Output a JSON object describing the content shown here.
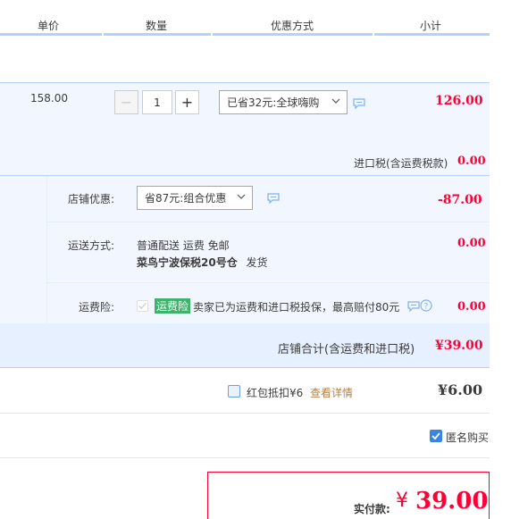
{
  "header": {
    "col_unit_price": "单价",
    "col_quantity": "数量",
    "col_discount": "优惠方式",
    "col_subtotal": "小计"
  },
  "item": {
    "unit_price": "158.00",
    "quantity": "1",
    "minus": "−",
    "plus": "+",
    "discount_select": "已省32元:全球嗨购",
    "subtotal": "126.00",
    "tax_label": "进口税(含运费税款)",
    "tax_value": "0.00"
  },
  "shop": {
    "promo_label": "店铺优惠:",
    "promo_select": "省87元:组合优惠",
    "promo_value": "-87.00",
    "shipping_label": "运送方式:",
    "shipping_line1": "普通配送 运费 免邮",
    "shipping_line2_bold": "菜鸟宁波保税20号仓",
    "shipping_line2_suffix": "发货",
    "shipping_value": "0.00",
    "insurance_label": "运费险:",
    "insurance_tag": "运费险",
    "insurance_text": "卖家已为运费和进口税投保，最高赔付80元",
    "insurance_value": "0.00",
    "total_label": "店铺合计(含运费和进口税)",
    "total_value": "¥39.00"
  },
  "hongbao": {
    "label": "红包抵扣¥6",
    "details_link": "查看详情",
    "value": "¥6.00"
  },
  "anonymous": {
    "label": "匿名购买"
  },
  "payment": {
    "label": "实付款:",
    "currency": "¥",
    "amount": "39.00"
  },
  "colors": {
    "accent_red": "#ff0036",
    "accent_blue": "#3a85e4",
    "tag_green": "#3db36c"
  }
}
